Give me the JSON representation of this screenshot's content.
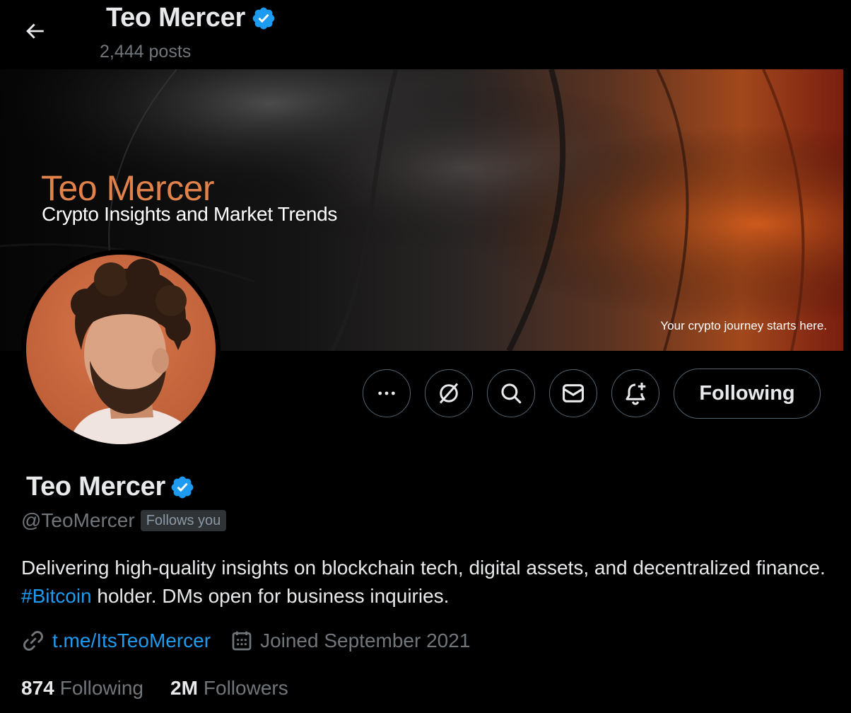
{
  "colors": {
    "background": "#000000",
    "text_primary": "#e7e9ea",
    "text_secondary": "#71767b",
    "accent_blue": "#1d9bf0",
    "border": "#536471",
    "banner_title": "#e0824a"
  },
  "header": {
    "back_icon": "arrow-left-icon",
    "name": "Teo Mercer",
    "verified_icon": "verified-badge-icon",
    "posts": "2,444 posts"
  },
  "banner": {
    "title": "Teo Mercer",
    "subtitle": "Crypto Insights and Market Trends",
    "tagline": "Your crypto journey starts here."
  },
  "actions": {
    "more_icon": "more-icon",
    "grok_icon": "grok-icon",
    "search_icon": "search-icon",
    "message_icon": "message-icon",
    "notify_icon": "bell-plus-icon",
    "following_label": "Following"
  },
  "profile": {
    "name": "Teo Mercer",
    "handle": "@TeoMercer",
    "follows_you": "Follows you",
    "bio_part1": "Delivering high-quality insights on blockchain tech, digital assets, and decentralized finance. ",
    "bio_hashtag": "#Bitcoin",
    "bio_part2": " holder. DMs open for business inquiries.",
    "link_icon": "link-icon",
    "link": "t.me/ItsTeoMercer",
    "calendar_icon": "calendar-icon",
    "joined": "Joined September 2021"
  },
  "stats": {
    "following_count": "874",
    "following_label": "Following",
    "followers_count": "2M",
    "followers_label": "Followers"
  }
}
